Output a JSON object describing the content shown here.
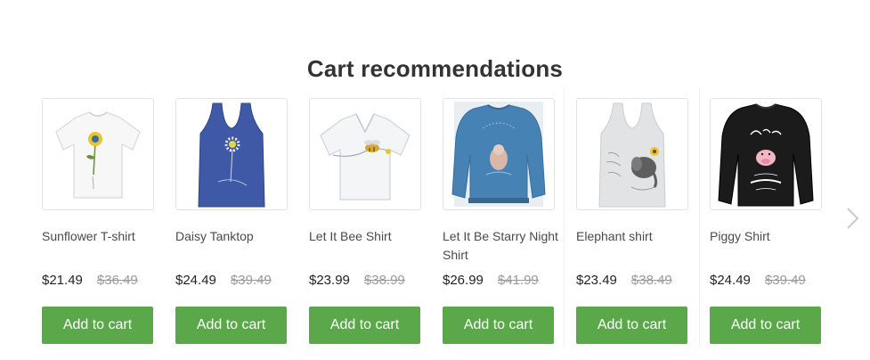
{
  "section": {
    "title": "Cart recommendations"
  },
  "products": [
    {
      "name": "Sunflower T-shirt",
      "price": "$21.49",
      "compare_price": "$36.49",
      "button_label": "Add to cart",
      "image_icon": "white-tshirt-sunflower-icon"
    },
    {
      "name": "Daisy Tanktop",
      "price": "$24.49",
      "compare_price": "$39.49",
      "button_label": "Add to cart",
      "image_icon": "blue-tanktop-daisy-icon"
    },
    {
      "name": "Let It Bee Shirt",
      "price": "$23.99",
      "compare_price": "$38.99",
      "button_label": "Add to cart",
      "image_icon": "white-vneck-bee-icon"
    },
    {
      "name": "Let It Be Starry Night Shirt",
      "price": "$26.99",
      "compare_price": "$41.99",
      "button_label": "Add to cart",
      "image_icon": "blue-sweatshirt-starry-icon"
    },
    {
      "name": "Elephant shirt",
      "price": "$23.49",
      "compare_price": "$38.49",
      "button_label": "Add to cart",
      "image_icon": "white-tanktop-elephant-icon"
    },
    {
      "name": "Piggy Shirt",
      "price": "$24.49",
      "compare_price": "$39.49",
      "button_label": "Add to cart",
      "image_icon": "black-longsleeve-piggy-icon"
    }
  ],
  "colors": {
    "button_green": "#5aa84a",
    "compare_price_gray": "#9a9a9a"
  },
  "navigation": {
    "next_icon": "chevron-right-icon"
  }
}
